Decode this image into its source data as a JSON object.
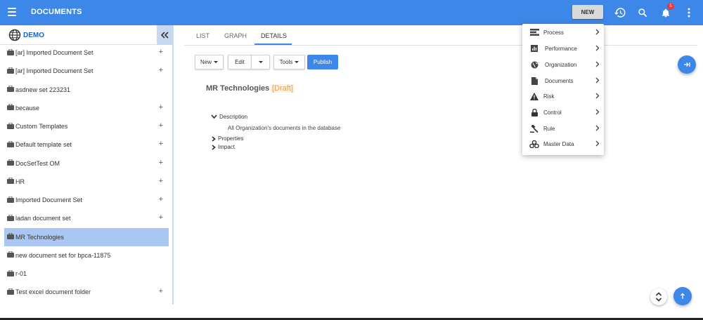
{
  "header": {
    "title": "DOCUMENTS",
    "new_label": "NEW",
    "notifications_count": "5",
    "accent_color": "#3c87e8"
  },
  "sidebar": {
    "workspace": "DEMO",
    "items": [
      {
        "label": "[ar] Imported Document Set",
        "expandable": true
      },
      {
        "label": "[ar] Imported Document Set",
        "expandable": true
      },
      {
        "label": "asdnew set 223231",
        "expandable": false
      },
      {
        "label": "because",
        "expandable": true
      },
      {
        "label": "Custom Templates",
        "expandable": true
      },
      {
        "label": "Default template set",
        "expandable": true
      },
      {
        "label": "DocSetTest OM",
        "expandable": true
      },
      {
        "label": "HR",
        "expandable": true
      },
      {
        "label": "Imported Document Set",
        "expandable": true
      },
      {
        "label": "ladan document set",
        "expandable": true
      },
      {
        "label": "MR Technologies",
        "expandable": false,
        "selected": true
      },
      {
        "label": "new document set for bpca-11875",
        "expandable": false
      },
      {
        "label": "r-01",
        "expandable": false
      },
      {
        "label": "Test excel document folder",
        "expandable": true
      }
    ]
  },
  "tabs": [
    {
      "label": "LIST"
    },
    {
      "label": "GRAPH"
    },
    {
      "label": "DETAILS",
      "active": true
    }
  ],
  "toolbar": {
    "new_label": "New",
    "edit_label": "Edit",
    "tools_label": "Tools",
    "publish_label": "Publish"
  },
  "document": {
    "title": "MR Technologies",
    "status": "[Draft]",
    "sections": {
      "description_label": "Description",
      "description_text": "All Organization's documents in the database",
      "properties_label": "Properties",
      "impact_label": "Impact"
    }
  },
  "new_menu": {
    "items": [
      {
        "label": "Process",
        "icon": "process-icon"
      },
      {
        "label": "Performance",
        "icon": "performance-icon"
      },
      {
        "label": "Organization",
        "icon": "globe-icon"
      },
      {
        "label": "Documents",
        "icon": "document-icon"
      },
      {
        "label": "Risk",
        "icon": "warning-icon"
      },
      {
        "label": "Control",
        "icon": "lock-icon"
      },
      {
        "label": "Rule",
        "icon": "gavel-icon"
      },
      {
        "label": "Master Data",
        "icon": "cubes-icon"
      }
    ]
  }
}
